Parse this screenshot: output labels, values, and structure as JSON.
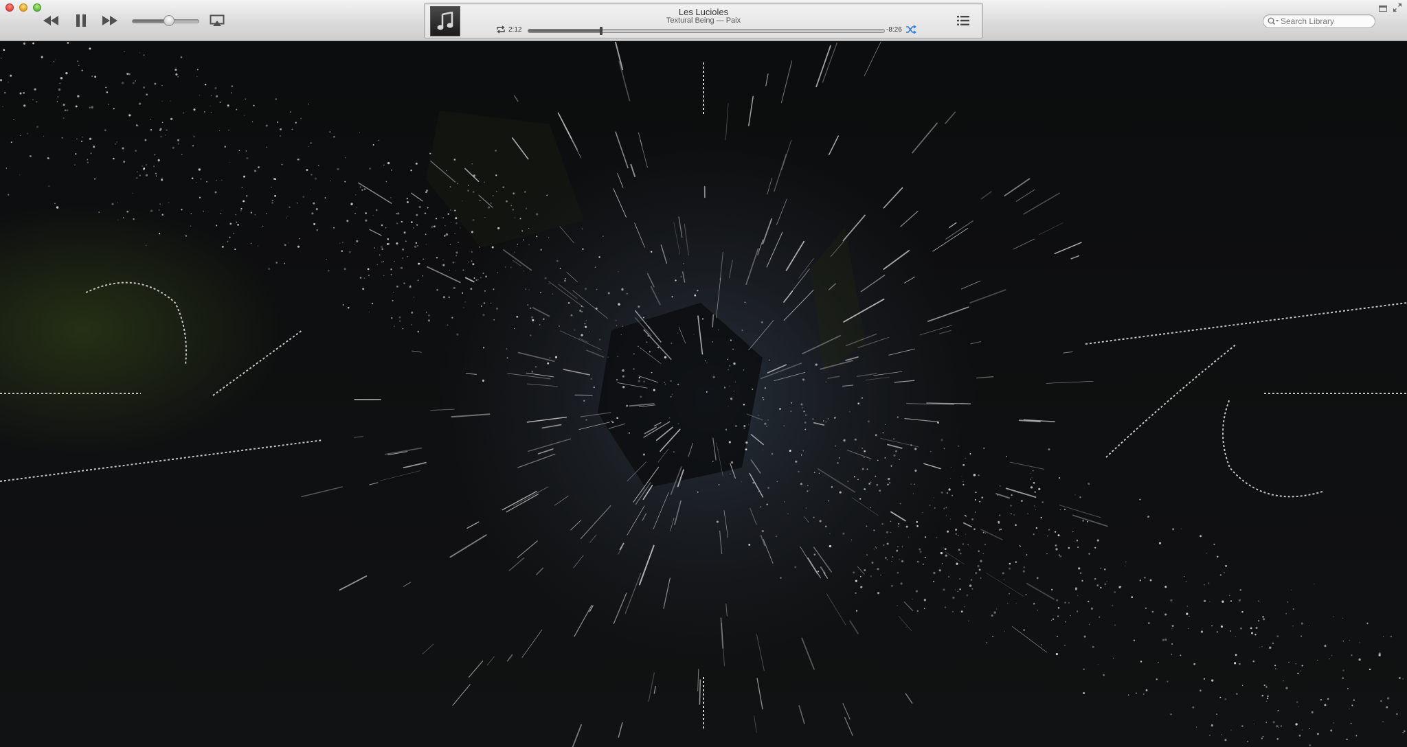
{
  "window": {
    "controls": [
      "close",
      "minimize",
      "zoom"
    ]
  },
  "playback": {
    "rewind_icon": "rewind-icon",
    "pause_icon": "pause-icon",
    "forward_icon": "fast-forward-icon",
    "airplay_icon": "airplay-icon",
    "volume_level": 0.55
  },
  "now_playing": {
    "title": "Les Lucioles",
    "subtitle": "Textural Being — Paix",
    "elapsed": "2:12",
    "remaining": "-8:26",
    "progress": 0.205,
    "artwork_icon": "music-note-icon",
    "repeat_icon": "repeat-icon",
    "shuffle_icon": "shuffle-icon",
    "up_next_icon": "list-icon"
  },
  "search": {
    "placeholder": "Search Library",
    "value": ""
  },
  "colors": {
    "accent_blue": "#2f7fd8",
    "toolbar_top": "#f3f3f3",
    "toolbar_bottom": "#cfcfcf",
    "visualizer_bg": "#0c0d0e"
  }
}
